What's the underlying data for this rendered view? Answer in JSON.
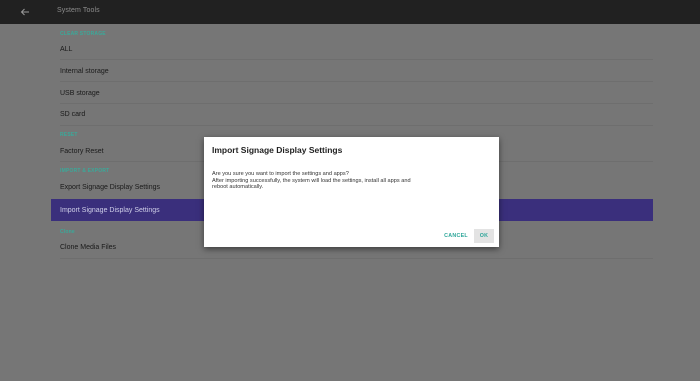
{
  "topbar": {
    "title": "System Tools",
    "back_icon": "arrow-left-icon"
  },
  "sections": [
    {
      "header": "CLEAR STORAGE",
      "items": [
        "ALL",
        "Internal storage",
        "USB storage",
        "SD card"
      ]
    },
    {
      "header": "RESET",
      "items": [
        "Factory Reset"
      ]
    },
    {
      "header": "IMPORT & EXPORT",
      "items": [
        "Export Signage Display Settings",
        "Import Signage Display Settings"
      ]
    },
    {
      "header": "Clone",
      "items": [
        "Clone Media Files"
      ]
    }
  ],
  "dialog": {
    "title": "Import Signage Display Settings",
    "line1": "Are you sure you want to import the settings and apps?",
    "line2": "After importing successfully, the system will load the settings, install all apps and",
    "line3": "reboot automatically.",
    "cancel_label": "CANCEL",
    "ok_label": "OK"
  },
  "colors": {
    "accent": "#3aa99a",
    "highlight": "#3a2f7c",
    "topbar": "#212121",
    "background": "#767676"
  }
}
